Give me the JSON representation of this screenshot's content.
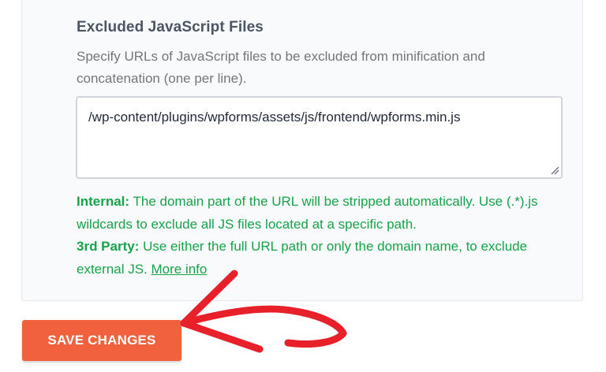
{
  "section": {
    "title": "Excluded JavaScript Files",
    "description": "Specify URLs of JavaScript files to be excluded from minification and concatenation (one per line).",
    "textarea_value": "/wp-content/plugins/wpforms/assets/js/frontend/wpforms.min.js"
  },
  "help": {
    "internal_label": "Internal:",
    "internal_text": " The domain part of the URL will be stripped automatically. Use (.*).js wildcards to exclude all JS files located at a specific path.",
    "third_party_label": "3rd Party:",
    "third_party_text": " Use either the full URL path or only the domain name, to exclude external JS. ",
    "more_info_link": "More info"
  },
  "actions": {
    "save_label": "SAVE CHANGES"
  },
  "colors": {
    "save_button": "#f2613d",
    "help_text": "#16a34a",
    "annotation_arrow": "#e8202a"
  },
  "icons": {
    "resize": "resize-handle-icon",
    "annotation": "annotation-arrow-icon"
  }
}
